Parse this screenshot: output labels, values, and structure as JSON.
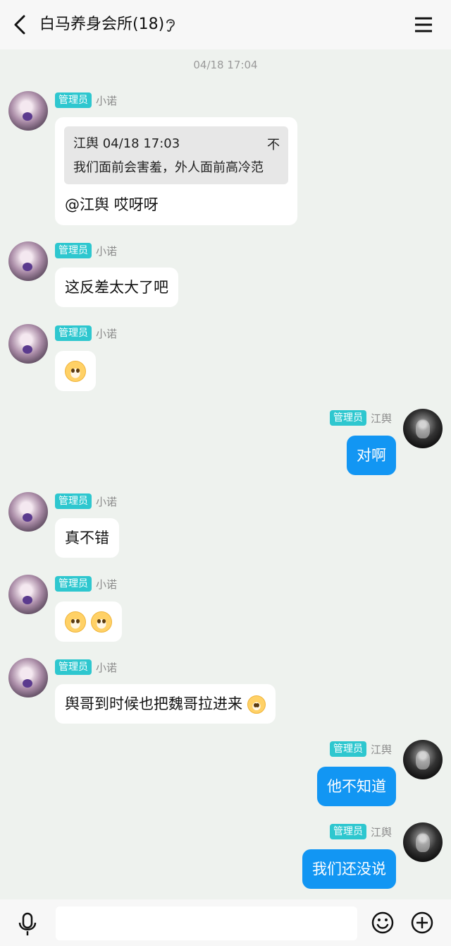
{
  "header": {
    "title": "白马养身会所(18)",
    "icons": {
      "back": "chevron-left-icon",
      "ear": "ear-icon",
      "menu": "menu-icon"
    }
  },
  "timestamp": "04/18 17:04",
  "badge_label": "管理员",
  "senders": {
    "left": "小诺",
    "right": "江舆"
  },
  "messages": {
    "m1": {
      "quote_author": "江舆",
      "quote_time": "04/18 17:03",
      "quote_pin": "不",
      "quote_text": "我们面前会害羞，外人面前高冷范",
      "text": "@江舆 哎呀呀"
    },
    "m2": {
      "text": "这反差太大了吧"
    },
    "m3": {
      "emoji": "doge-shiba-emoji"
    },
    "m4": {
      "text": "对啊"
    },
    "m5": {
      "text": "真不错"
    },
    "m6": {
      "emoji": "doge-pleading-emoji"
    },
    "m7": {
      "text": "舆哥到时候也把魏哥拉进来"
    },
    "m8": {
      "text": "他不知道"
    },
    "m9": {
      "text": "我们还没说"
    }
  },
  "bottom_bar": {
    "input_placeholder": "",
    "icons": {
      "mic": "microphone-icon",
      "emoji": "smiley-icon",
      "more": "plus-circle-icon"
    }
  },
  "colors": {
    "accent_blue": "#1296f3",
    "badge_teal": "#2ec7cf",
    "background": "#eef2ee"
  }
}
